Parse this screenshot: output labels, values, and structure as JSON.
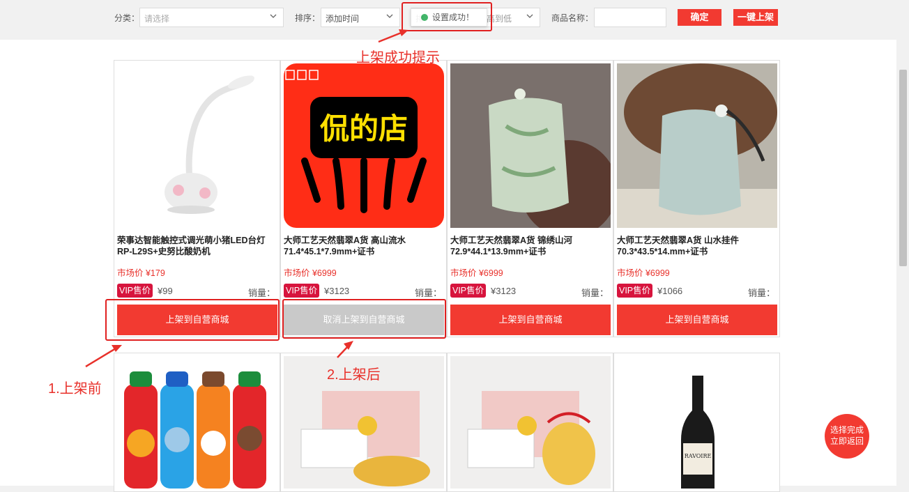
{
  "filters": {
    "category_label": "分类：",
    "category_placeholder": "请选择",
    "sort_label": "排序：",
    "sort_value": "添加时间",
    "sort2_label": "排",
    "sort2_value": "高到低",
    "product_name_label": "商品名称：",
    "product_name_value": "",
    "confirm_label": "确定",
    "bulk_list_label": "一键上架"
  },
  "toast": {
    "text": "设置成功！"
  },
  "annotations": {
    "success_tip": "上架成功提示",
    "before": "1.上架前",
    "after": "2.上架后"
  },
  "products": [
    {
      "title": "荣事达智能触控式调光萌小猪LED台灯RP-L29S+史努比酸奶机",
      "market": "市场价 ¥179",
      "vip_label": "VIP售价",
      "vip_price": "¥99",
      "sales_label": "销量：",
      "action": "上架到自营商城",
      "listed": false
    },
    {
      "title": "大师工艺天然翡翠A货 高山流水71.4*45.1*7.9mm+证书",
      "market": "市场价 ¥6999",
      "vip_label": "VIP售价",
      "vip_price": "¥3123",
      "sales_label": "销量：",
      "action": "取消上架到自营商城",
      "listed": true,
      "image_text": "侃的店"
    },
    {
      "title": "大师工艺天然翡翠A货 锦绣山河72.9*44.1*13.9mm+证书",
      "market": "市场价 ¥6999",
      "vip_label": "VIP售价",
      "vip_price": "¥3123",
      "sales_label": "销量：",
      "action": "上架到自营商城",
      "listed": false
    },
    {
      "title": "大师工艺天然翡翠A货 山水挂件70.3*43.5*14.mm+证书",
      "market": "市场价 ¥6999",
      "vip_label": "VIP售价",
      "vip_price": "¥1066",
      "sales_label": "销量：",
      "action": "上架到自营商城",
      "listed": false
    }
  ],
  "float_button": {
    "line1": "选择完成",
    "line2": "立即返回"
  },
  "colors": {
    "accent": "#f23a31",
    "vip": "#d7143d",
    "annotation": "#e8302a"
  }
}
